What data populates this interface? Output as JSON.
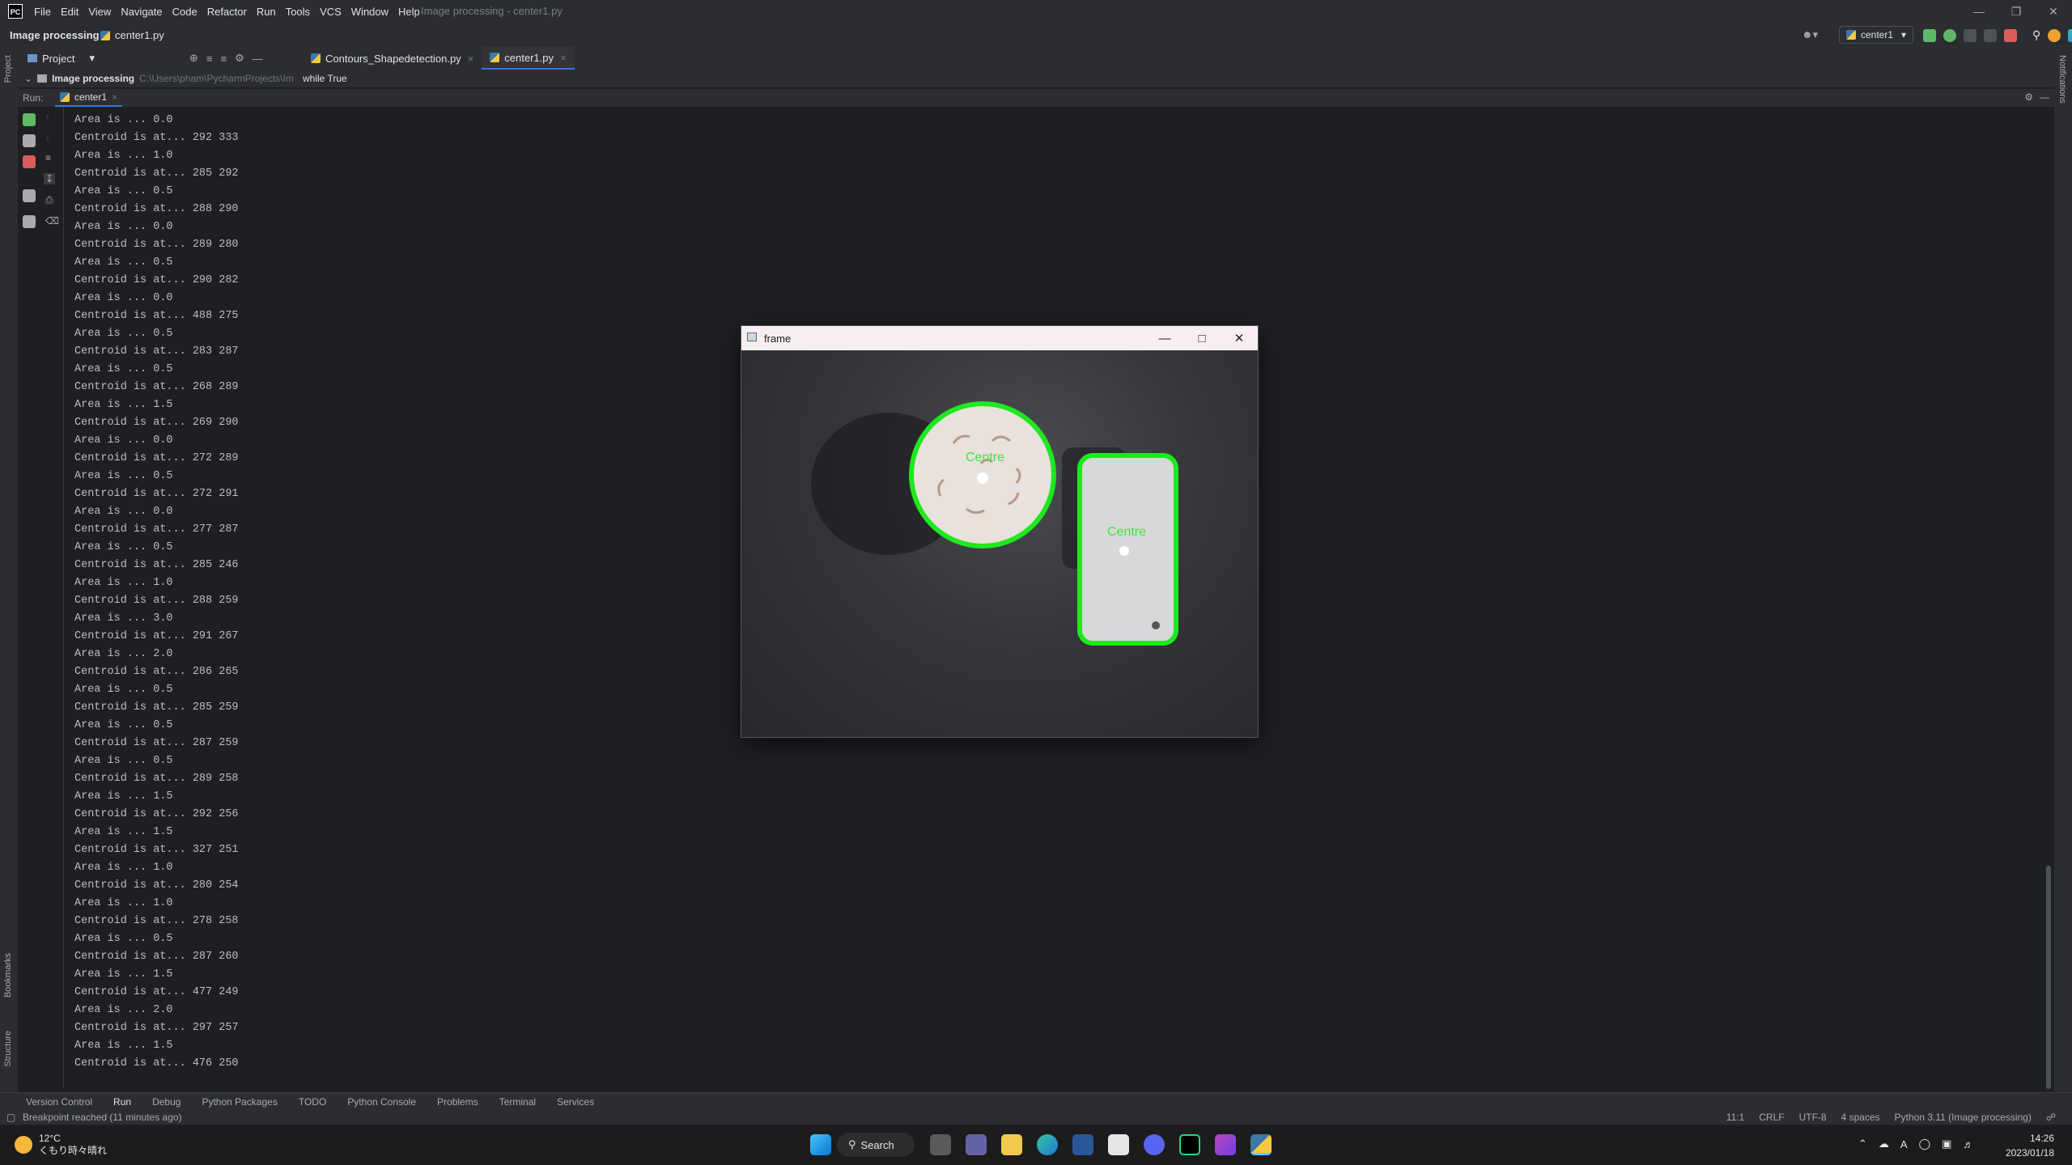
{
  "menu": [
    "File",
    "Edit",
    "View",
    "Navigate",
    "Code",
    "Refactor",
    "Run",
    "Tools",
    "VCS",
    "Window",
    "Help"
  ],
  "window_title": "Image processing - center1.py",
  "nav": {
    "project": "Image processing",
    "file": "center1.py",
    "run_config": "center1"
  },
  "project_panel": {
    "label": "Project",
    "root_name": "Image processing",
    "root_path": "C:\\Users\\pham\\PycharmProjects\\Im"
  },
  "tabs": [
    {
      "label": "Contours_Shapedetection.py"
    },
    {
      "label": "center1.py"
    }
  ],
  "breadcrumb": "while True",
  "left_stripe": {
    "project": "Project",
    "bookmarks": "Bookmarks",
    "structure": "Structure"
  },
  "right_stripe": {
    "notifications": "Notifications"
  },
  "run_panel": {
    "label": "Run:",
    "tab": "center1"
  },
  "console_lines": [
    "Area is ... 0.0",
    "Centroid is at... 292 333",
    "Area is ... 1.0",
    "Centroid is at... 285 292",
    "Area is ... 0.5",
    "Centroid is at... 288 290",
    "Area is ... 0.0",
    "Centroid is at... 289 280",
    "Area is ... 0.5",
    "Centroid is at... 290 282",
    "Area is ... 0.0",
    "Centroid is at... 488 275",
    "Area is ... 0.5",
    "Centroid is at... 283 287",
    "Area is ... 0.5",
    "Centroid is at... 268 289",
    "Area is ... 1.5",
    "Centroid is at... 269 290",
    "Area is ... 0.0",
    "Centroid is at... 272 289",
    "Area is ... 0.5",
    "Centroid is at... 272 291",
    "Area is ... 0.0",
    "Centroid is at... 277 287",
    "Area is ... 0.5",
    "Centroid is at... 285 246",
    "Area is ... 1.0",
    "Centroid is at... 288 259",
    "Area is ... 3.0",
    "Centroid is at... 291 267",
    "Area is ... 2.0",
    "Centroid is at... 286 265",
    "Area is ... 0.5",
    "Centroid is at... 285 259",
    "Area is ... 0.5",
    "Centroid is at... 287 259",
    "Area is ... 0.5",
    "Centroid is at... 289 258",
    "Area is ... 1.5",
    "Centroid is at... 292 256",
    "Area is ... 1.5",
    "Centroid is at... 327 251",
    "Area is ... 1.0",
    "Centroid is at... 280 254",
    "Area is ... 1.0",
    "Centroid is at... 278 258",
    "Area is ... 0.5",
    "Centroid is at... 287 260",
    "Area is ... 1.5",
    "Centroid is at... 477 249",
    "Area is ... 2.0",
    "Centroid is at... 297 257",
    "Area is ... 1.5",
    "Centroid is at... 476 250"
  ],
  "tool_tabs": [
    "Version Control",
    "Run",
    "Debug",
    "Python Packages",
    "TODO",
    "Python Console",
    "Problems",
    "Terminal",
    "Services"
  ],
  "status": {
    "message": "Breakpoint reached (11 minutes ago)",
    "position": "11:1",
    "line_sep": "CRLF",
    "encoding": "UTF-8",
    "indent": "4 spaces",
    "interpreter": "Python 3.11 (Image processing)"
  },
  "frame_window": {
    "title": "frame",
    "labels": [
      "Centre",
      "Centre"
    ]
  },
  "taskbar": {
    "weather_temp": "12°C",
    "weather_desc": "くもり時々晴れ",
    "search": "Search",
    "time": "14:26",
    "date": "2023/01/18",
    "ime": "A"
  },
  "colors": {
    "accent": "#3574f0",
    "contour": "#1ee81e",
    "stop": "#db5c5c",
    "run": "#5fb865"
  }
}
